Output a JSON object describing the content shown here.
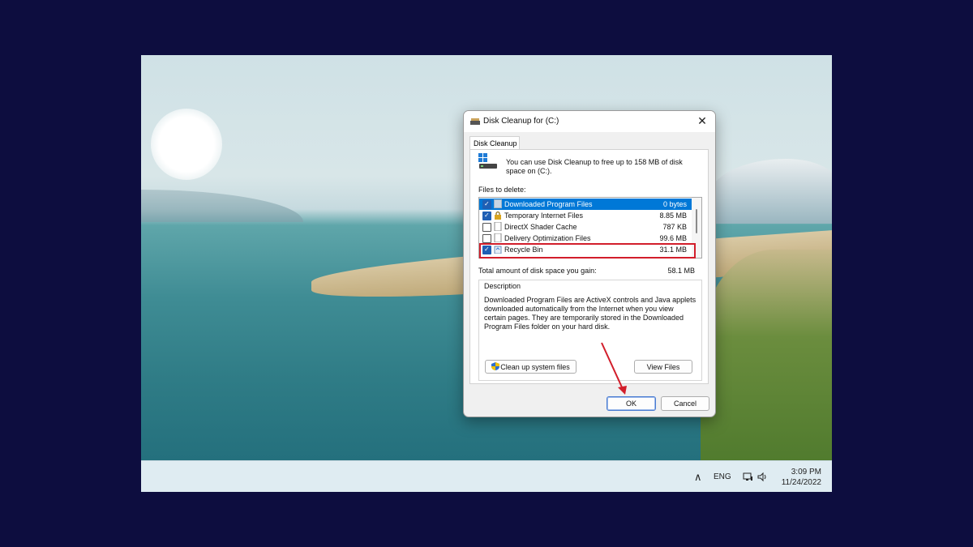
{
  "taskbar": {
    "chevron": "∧",
    "language": "ENG",
    "network_icon": "network-icon",
    "volume_icon": "volume-icon",
    "time": "3:09 PM",
    "date": "11/24/2022"
  },
  "dialog": {
    "title": "Disk Cleanup for  (C:)",
    "close_glyph": "✕",
    "tab": "Disk Cleanup",
    "intro": "You can use Disk Cleanup to free up to 158 MB of disk space on  (C:).",
    "files_label": "Files to delete:",
    "files": [
      {
        "name": "Downloaded Program Files",
        "size": "0 bytes",
        "checked": true,
        "selected": true,
        "icon": "folder-icon"
      },
      {
        "name": "Temporary Internet Files",
        "size": "8.85 MB",
        "checked": true,
        "selected": false,
        "icon": "lock-icon"
      },
      {
        "name": "DirectX Shader Cache",
        "size": "787 KB",
        "checked": false,
        "selected": false,
        "icon": "file-icon"
      },
      {
        "name": "Delivery Optimization Files",
        "size": "99.6 MB",
        "checked": false,
        "selected": false,
        "icon": "file-icon"
      },
      {
        "name": "Recycle Bin",
        "size": "31.1 MB",
        "checked": true,
        "selected": false,
        "icon": "recycle-bin-icon"
      }
    ],
    "total_label": "Total amount of disk space you gain:",
    "total_value": "58.1 MB",
    "description_label": "Description",
    "description": "Downloaded Program Files are ActiveX controls and Java applets downloaded automatically from the Internet when you view certain pages. They are temporarily stored in the Downloaded Program Files folder on your hard disk.",
    "cleanup_system_label": "Clean up system files",
    "view_files_label": "View Files",
    "ok_label": "OK",
    "cancel_label": "Cancel"
  },
  "annotation_colors": {
    "highlight": "#d21e2b",
    "arrow": "#d21e2b"
  }
}
